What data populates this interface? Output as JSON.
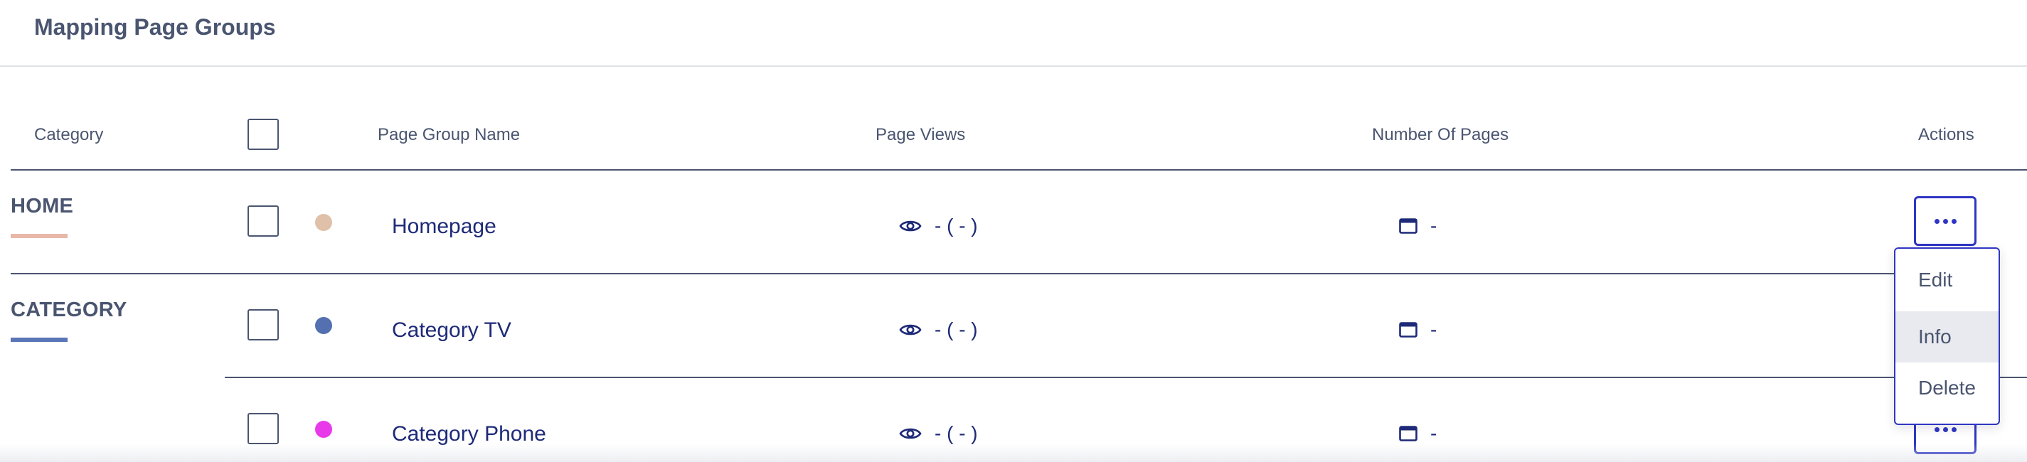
{
  "page": {
    "title": "Mapping Page Groups"
  },
  "table": {
    "headers": {
      "category": "Category",
      "page_group_name": "Page Group Name",
      "page_views": "Page Views",
      "number_of_pages": "Number Of Pages",
      "actions": "Actions"
    },
    "categories": [
      {
        "label": "HOME",
        "color": "#e8b8a8"
      },
      {
        "label": "CATEGORY",
        "color": "#5a75b8"
      }
    ],
    "rows": [
      {
        "name": "Homepage",
        "dot_color": "#e0c0a8",
        "views": "- ( - )",
        "pages": "-"
      },
      {
        "name": "Category TV",
        "dot_color": "#5470b0",
        "views": "- ( - )",
        "pages": "-"
      },
      {
        "name": "Category Phone",
        "dot_color": "#e93ae9",
        "views": "- ( - )",
        "pages": "-"
      }
    ]
  },
  "actions_menu": {
    "items": [
      "Edit",
      "Info",
      "Delete"
    ],
    "highlighted": "Info"
  },
  "colors": {
    "accent": "#2f36c2",
    "text_dark": "#1e2a78",
    "text_muted": "#4a5570"
  }
}
